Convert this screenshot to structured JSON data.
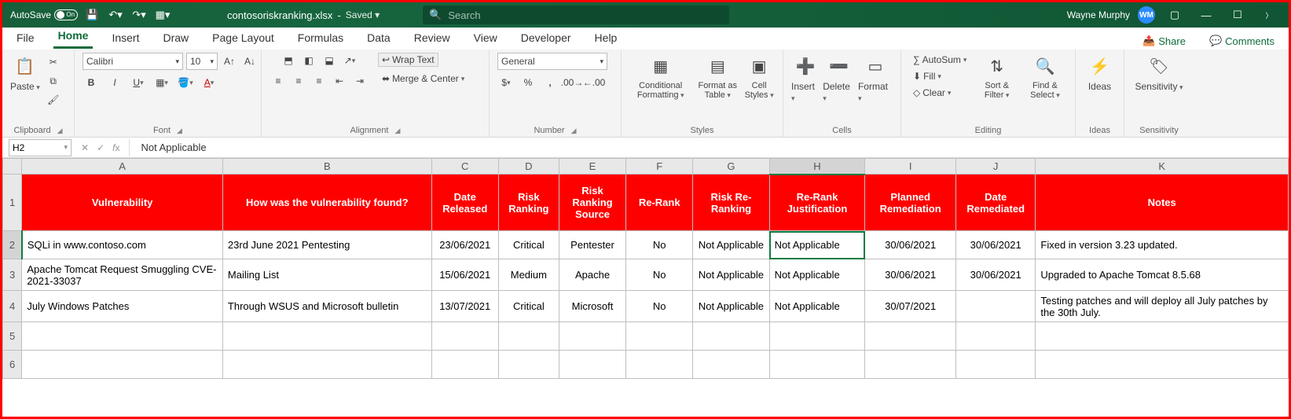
{
  "titlebar": {
    "autosave_label": "AutoSave",
    "autosave_state": "On",
    "filename": "contosoriskranking.xlsx",
    "saved_state": "Saved",
    "search_placeholder": "Search",
    "username": "Wayne Murphy",
    "user_initials": "WM"
  },
  "tabs": {
    "items": [
      "File",
      "Home",
      "Insert",
      "Draw",
      "Page Layout",
      "Formulas",
      "Data",
      "Review",
      "View",
      "Developer",
      "Help"
    ],
    "active": "Home",
    "share": "Share",
    "comments": "Comments"
  },
  "ribbon": {
    "clipboard": {
      "paste": "Paste",
      "label": "Clipboard"
    },
    "font": {
      "name": "Calibri",
      "size": "10",
      "label": "Font"
    },
    "alignment": {
      "wrap": "Wrap Text",
      "merge": "Merge & Center",
      "label": "Alignment"
    },
    "number": {
      "format": "General",
      "label": "Number"
    },
    "styles": {
      "cond": "Conditional Formatting",
      "table": "Format as Table",
      "cell": "Cell Styles",
      "label": "Styles"
    },
    "cells": {
      "insert": "Insert",
      "delete": "Delete",
      "format": "Format",
      "label": "Cells"
    },
    "editing": {
      "autosum": "AutoSum",
      "fill": "Fill",
      "clear": "Clear",
      "sort": "Sort & Filter",
      "find": "Find & Select",
      "label": "Editing"
    },
    "ideas": {
      "btn": "Ideas",
      "label": "Ideas"
    },
    "sensitivity": {
      "btn": "Sensitivity",
      "label": "Sensitivity"
    }
  },
  "formula_bar": {
    "cell_ref": "H2",
    "value": "Not Applicable"
  },
  "sheet": {
    "columns": [
      "A",
      "B",
      "C",
      "D",
      "E",
      "F",
      "G",
      "H",
      "I",
      "J",
      "K"
    ],
    "selected_col": "H",
    "selected_row": "2",
    "headers": {
      "A": "Vulnerability",
      "B": "How was the vulnerability found?",
      "C": "Date Released",
      "D": "Risk Ranking",
      "E": "Risk Ranking Source",
      "F": "Re-Rank",
      "G": "Risk Re-Ranking",
      "H": "Re-Rank Justification",
      "I": "Planned Remediation",
      "J": "Date Remediated",
      "K": "Notes"
    },
    "rows": [
      {
        "n": "2",
        "A": "SQLi in www.contoso.com",
        "B": "23rd June 2021 Pentesting",
        "C": "23/06/2021",
        "D": "Critical",
        "E": "Pentester",
        "F": "No",
        "G": "Not Applicable",
        "H": "Not Applicable",
        "I": "30/06/2021",
        "J": "30/06/2021",
        "K": "Fixed in version 3.23 updated."
      },
      {
        "n": "3",
        "A": "Apache Tomcat Request Smuggling CVE-2021-33037",
        "B": "Mailing List",
        "C": "15/06/2021",
        "D": "Medium",
        "E": "Apache",
        "F": "No",
        "G": "Not Applicable",
        "H": "Not Applicable",
        "I": "30/06/2021",
        "J": "30/06/2021",
        "K": "Upgraded to Apache Tomcat 8.5.68"
      },
      {
        "n": "4",
        "A": "July Windows Patches",
        "B": "Through WSUS and Microsoft bulletin",
        "C": "13/07/2021",
        "D": "Critical",
        "E": "Microsoft",
        "F": "No",
        "G": "Not Applicable",
        "H": "Not Applicable",
        "I": "30/07/2021",
        "J": "",
        "K": "Testing patches and will deploy all July patches by the 30th July."
      },
      {
        "n": "5",
        "A": "",
        "B": "",
        "C": "",
        "D": "",
        "E": "",
        "F": "",
        "G": "",
        "H": "",
        "I": "",
        "J": "",
        "K": ""
      },
      {
        "n": "6",
        "A": "",
        "B": "",
        "C": "",
        "D": "",
        "E": "",
        "F": "",
        "G": "",
        "H": "",
        "I": "",
        "J": "",
        "K": ""
      }
    ]
  }
}
